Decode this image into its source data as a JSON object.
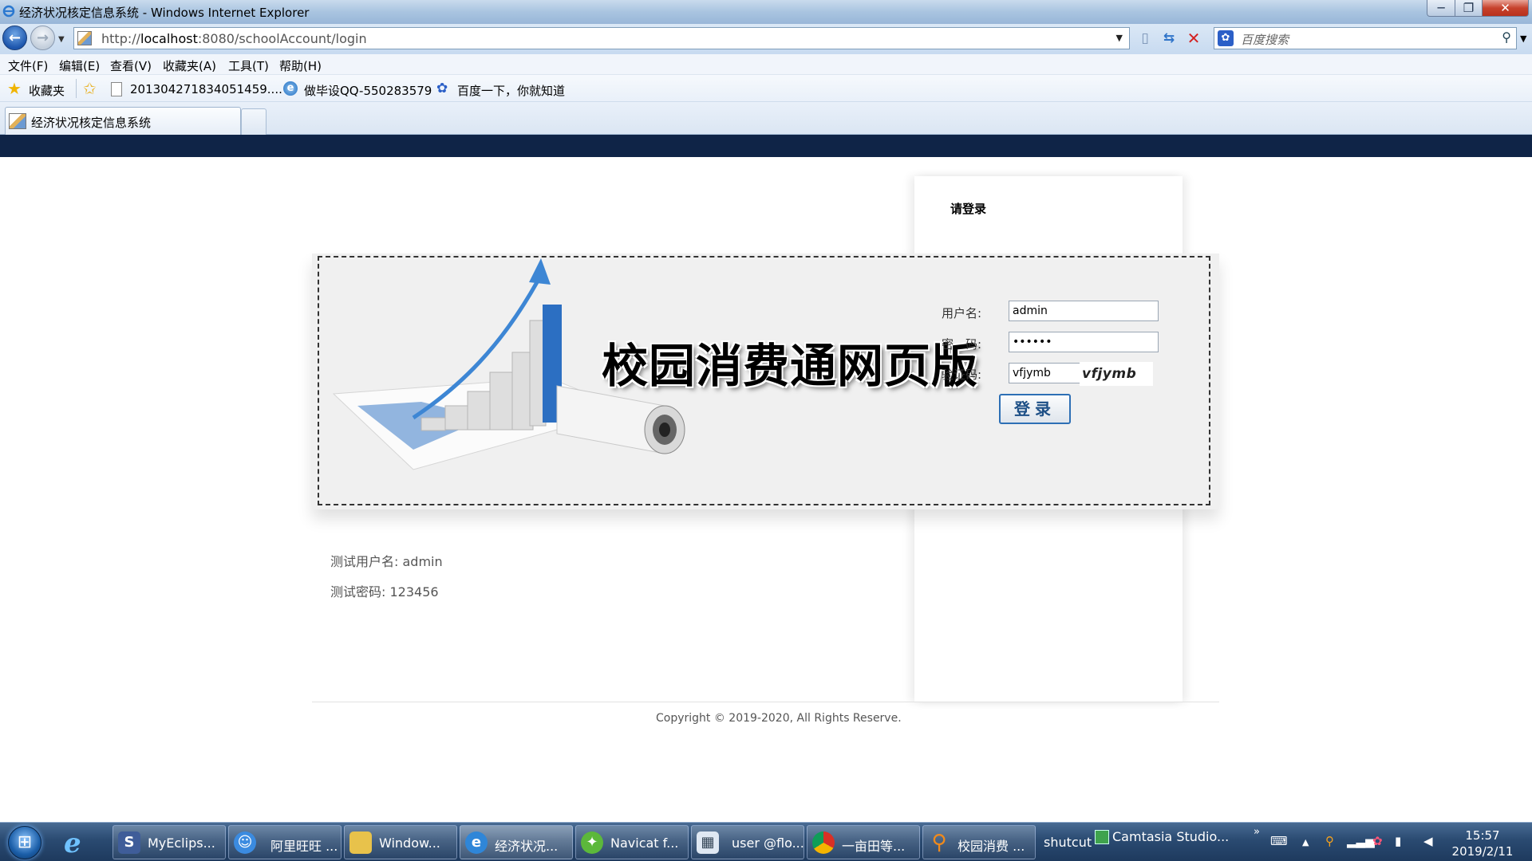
{
  "window": {
    "title": "经济状况核定信息系统 - Windows Internet Explorer",
    "min_glyph": "─",
    "max_glyph": "❐",
    "close_glyph": "✕"
  },
  "address_bar": {
    "url_prefix": "http://",
    "url_host": "localhost",
    "url_rest": ":8080/schoolAccount/login"
  },
  "search": {
    "placeholder": "百度搜索"
  },
  "menu": [
    "文件(F)",
    "编辑(E)",
    "查看(V)",
    "收藏夹(A)",
    "工具(T)",
    "帮助(H)"
  ],
  "favorites": {
    "label": "收藏夹",
    "items": [
      "201304271834051459....",
      "做毕设QQ-550283579",
      "百度一下，你就知道"
    ]
  },
  "tab": {
    "label": "经济状况核定信息系统"
  },
  "page": {
    "panel_header": "请登录",
    "banner_title": "校园消费通网页版",
    "form": {
      "username_label": "用户名:",
      "username_value": "admin",
      "password_label": "密　码:",
      "password_value": "123456",
      "captcha_label": "验证码:",
      "captcha_value": "vfjymb",
      "captcha_image_text": "vfjymb",
      "submit_label": "登录"
    },
    "test_username": "测试用户名: admin",
    "test_password": "测试密码: 123456",
    "copyright": "Copyright © 2019-2020, All Rights Reserve."
  },
  "taskbar": {
    "tasks": [
      "MyEclips...",
      "阿里旺旺 ...",
      "Window...",
      "经济状况...",
      "Navicat f...",
      "user @flo...",
      "一亩田等...",
      "校园消费 ..."
    ],
    "extra": [
      "shutcut",
      "Camtasia Studio..."
    ],
    "clock_time": "15:57",
    "clock_date": "2019/2/11"
  },
  "colors": {
    "page_stripe": "#0f2447",
    "login_box_bg": "#f0f0f0",
    "button_border": "#2d6fb5",
    "taskbar": "#2a4a71"
  },
  "icons": [
    "ie-logo-icon",
    "back-arrow-icon",
    "forward-arrow-icon",
    "page-icon",
    "compat-view-icon",
    "refresh-icon",
    "stop-icon",
    "baidu-paw-icon",
    "search-magnifier-icon",
    "favorites-star-icon",
    "add-favorite-icon",
    "start-orb-icon"
  ]
}
